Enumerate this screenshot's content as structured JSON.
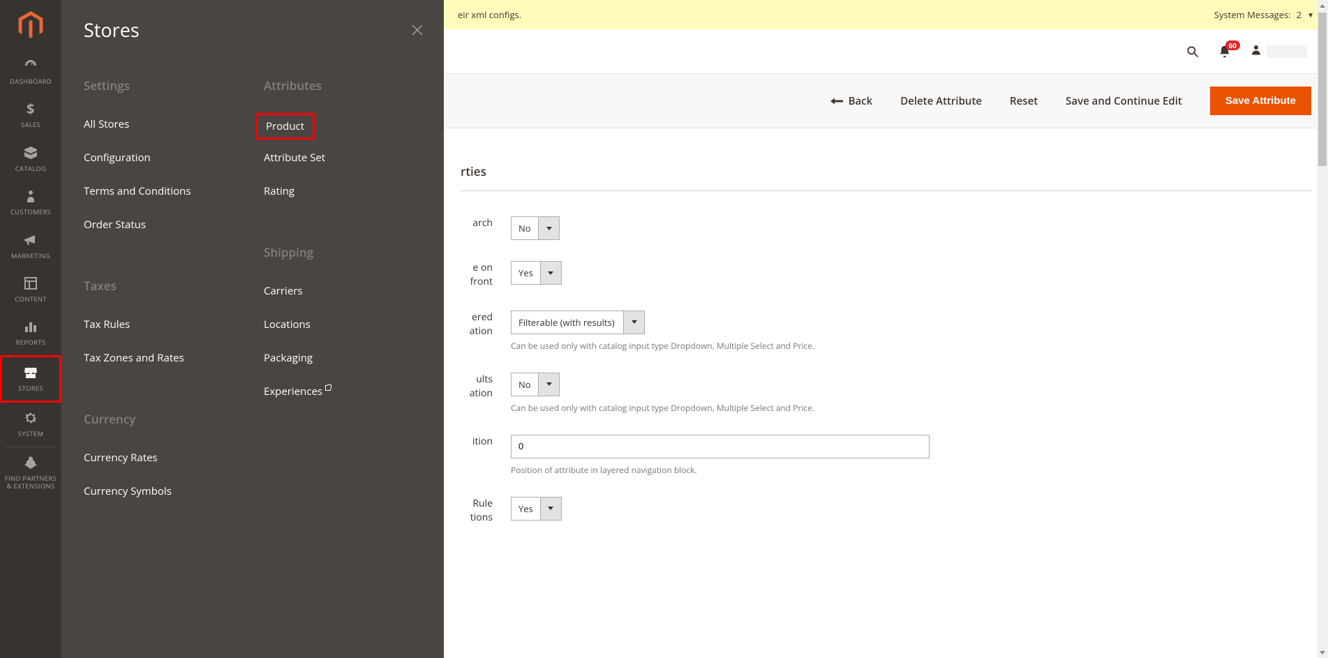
{
  "sidebar": {
    "items": [
      {
        "label": "DASHBOARD"
      },
      {
        "label": "SALES"
      },
      {
        "label": "CATALOG"
      },
      {
        "label": "CUSTOMERS"
      },
      {
        "label": "MARKETING"
      },
      {
        "label": "CONTENT"
      },
      {
        "label": "REPORTS"
      },
      {
        "label": "STORES"
      },
      {
        "label": "SYSTEM"
      },
      {
        "label": "FIND PARTNERS\n& EXTENSIONS"
      }
    ]
  },
  "flyout": {
    "title": "Stores",
    "groups": {
      "settings": {
        "title": "Settings",
        "links": [
          "All Stores",
          "Configuration",
          "Terms and Conditions",
          "Order Status"
        ]
      },
      "taxes": {
        "title": "Taxes",
        "links": [
          "Tax Rules",
          "Tax Zones and Rates"
        ]
      },
      "currency": {
        "title": "Currency",
        "links": [
          "Currency Rates",
          "Currency Symbols"
        ]
      },
      "attributes": {
        "title": "Attributes",
        "links": [
          "Product",
          "Attribute Set",
          "Rating"
        ]
      },
      "shipping": {
        "title": "Shipping",
        "links": [
          "Carriers",
          "Locations",
          "Packaging",
          "Experiences"
        ]
      }
    }
  },
  "sysmsg": {
    "left_fragment": "eir xml configs.",
    "right": "System Messages:",
    "count": "2"
  },
  "header": {
    "notif_badge": "60"
  },
  "toolbar": {
    "back": "Back",
    "delete": "Delete Attribute",
    "reset": "Reset",
    "save_continue": "Save and Continue Edit",
    "save": "Save Attribute"
  },
  "section": {
    "title_fragment": "rties"
  },
  "form": {
    "row1": {
      "label_frag": "arch",
      "value": "No"
    },
    "row2": {
      "label_frag": "e on\nfront",
      "value": "Yes"
    },
    "row3": {
      "label_frag": "ered\nation",
      "value": "Filterable (with results)",
      "help": "Can be used only with catalog input type Dropdown, Multiple Select and Price."
    },
    "row4": {
      "label_frag": "ults\nation",
      "value": "No",
      "help": "Can be used only with catalog input type Dropdown, Multiple Select and Price."
    },
    "row5": {
      "label_frag": "ition",
      "value": "0",
      "help": "Position of attribute in layered navigation block."
    },
    "row6": {
      "label_frag": "Rule\ntions",
      "value": "Yes"
    }
  }
}
